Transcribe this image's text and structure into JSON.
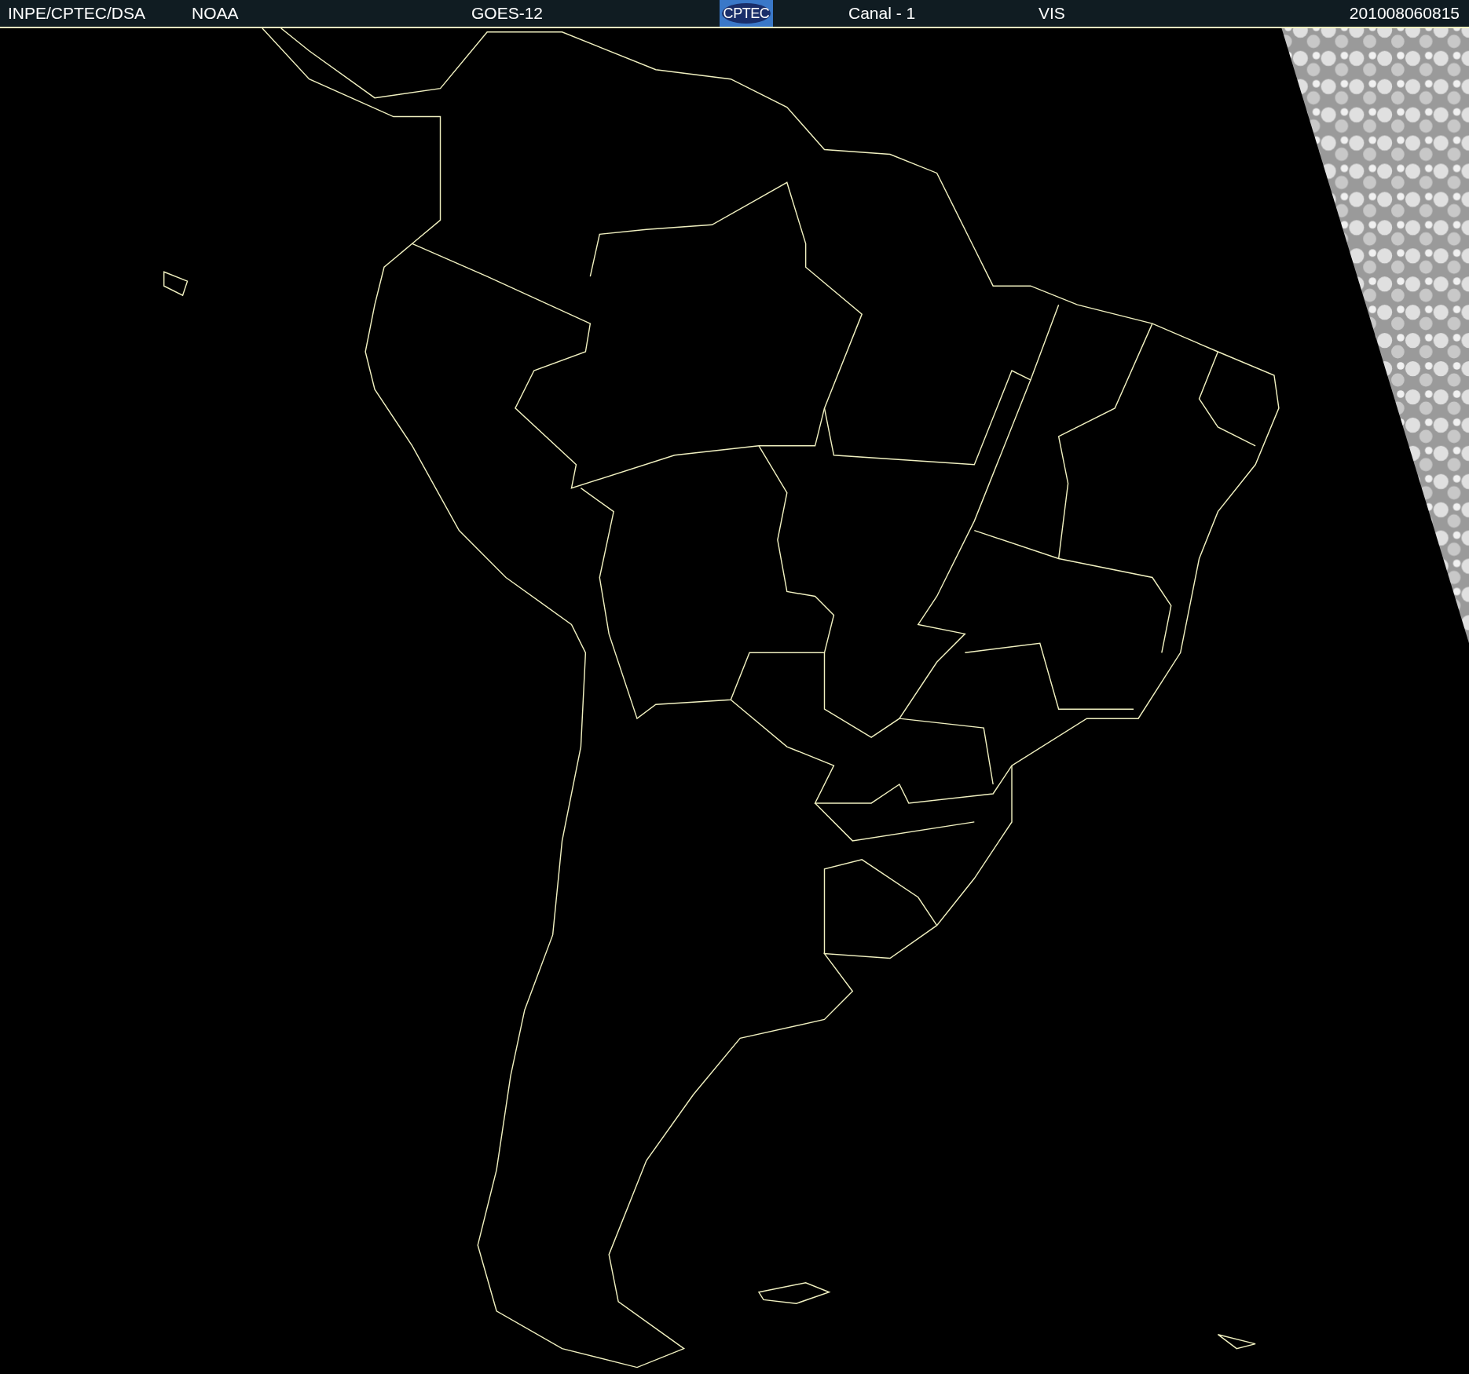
{
  "header": {
    "source": "INPE/CPTEC/DSA",
    "agency": "NOAA",
    "satellite": "GOES-12",
    "logo": "CPTEC",
    "channel": "Canal - 1",
    "band": "VIS",
    "timestamp": "201008060815"
  }
}
